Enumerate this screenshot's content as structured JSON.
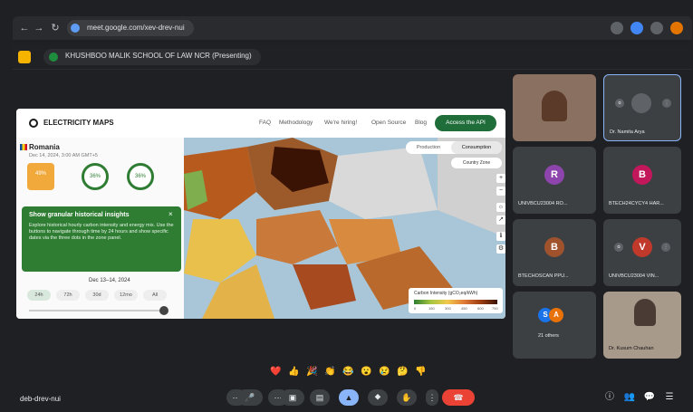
{
  "browser": {
    "url": "meet.google.com/xev-drev-nui",
    "back": "←",
    "forward": "→",
    "reload": "↻"
  },
  "presenting": {
    "title": "KHUSHBOO MALIK SCHOOL OF LAW NCR (Presenting)"
  },
  "shared": {
    "logo": "ELECTRICITY MAPS",
    "nav": [
      "FAQ",
      "Methodology",
      "We're hiring!",
      "Open Source",
      "Blog"
    ],
    "api_button": "Access the API",
    "panel": {
      "country": "Romania",
      "datetime": "Dec 14, 2024, 3:00 AM GMT+5",
      "gauges": [
        "49%",
        "36%",
        "36%"
      ],
      "insight_title": "Show granular historical insights",
      "insight_text": "Explore historical hourly carbon intensity and energy mix. Use the buttons to navigate through time by 24 hours and show specific dates via the three dots in the zone panel.",
      "date_range": "Dec 13–14, 2024",
      "periods": [
        "24h",
        "72h",
        "30d",
        "12mo",
        "All"
      ]
    },
    "map": {
      "toggle": [
        "Production",
        "Consumption"
      ],
      "selector": "Country  Zone",
      "controls": [
        "+",
        "−",
        "☼",
        "↗",
        "ℹ",
        "⚙"
      ],
      "legend_title": "Carbon Intensity (gCO₂eq/kWh)",
      "legend_ticks": [
        "0",
        "150",
        "300",
        "450",
        "600",
        "750"
      ]
    }
  },
  "participants": [
    {
      "name": "",
      "initial": "",
      "color": "#7a5a4a",
      "video": true
    },
    {
      "name": "Dr. Namita Arya",
      "initial": "",
      "color": "#5f6368",
      "video": false
    },
    {
      "name": "UNIVBCU23004 RO...",
      "initial": "R",
      "color": "#8e44ad"
    },
    {
      "name": "BTECH24CYCY4 HAR...",
      "initial": "B",
      "color": "#c2185b"
    },
    {
      "name": "BTECHOSCAN PPU...",
      "initial": "B",
      "color": "#a0522d"
    },
    {
      "name": "UNIVBCU23004 VIN...",
      "initial": "V",
      "color": "#c0392b"
    },
    {
      "name": "21 others",
      "initial": "",
      "color": "#1a73e8"
    },
    {
      "name": "Dr. Kusum Chauhan",
      "initial": "",
      "color": "#6d4c41",
      "video": true
    }
  ],
  "reactions": [
    "❤️",
    "👍",
    "🎉",
    "👏",
    "😂",
    "😮",
    "😢",
    "🤔",
    "👎"
  ],
  "bottom": {
    "meeting_code": "deb-drev-nui",
    "controls": [
      "⋯",
      "🎤",
      "⋯",
      "▣",
      "▤",
      "▲",
      "⯁",
      "✋",
      "⋮"
    ],
    "end": "☎",
    "right_icons": [
      "ⓘ",
      "👥",
      "💬",
      "☰"
    ]
  }
}
